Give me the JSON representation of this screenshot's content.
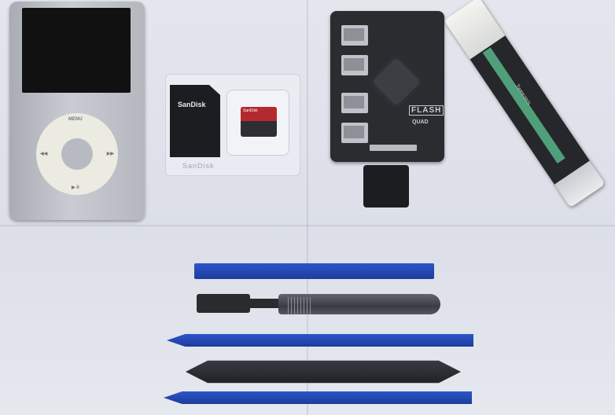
{
  "ipod": {
    "wheel_top": "MENU",
    "wheel_left": "◀◀",
    "wheel_right": "▶▶",
    "wheel_bottom": "▶ II"
  },
  "sd_card": {
    "adapter_brand": "SanDisk",
    "micro_brand": "SanDisk"
  },
  "blister_text": "SanDisk",
  "board": {
    "label": "FLASH",
    "sublabel": "QUAD"
  },
  "tweezers": {
    "text": "Tweezers"
  }
}
